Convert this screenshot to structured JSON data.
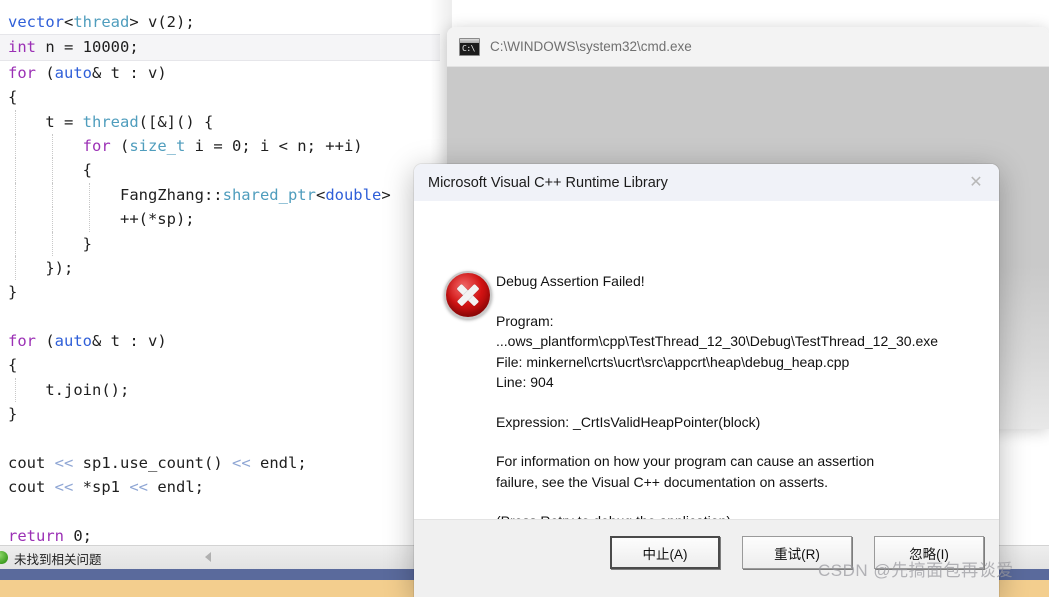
{
  "editor": {
    "lines": [
      {
        "indent": 0,
        "tokens": [
          {
            "t": "vector",
            "c": "bl"
          },
          {
            "t": "<",
            "c": "pl"
          },
          {
            "t": "thread",
            "c": "ty"
          },
          {
            "t": "> v(2);",
            "c": "pl"
          }
        ],
        "current": false,
        "guides": []
      },
      {
        "indent": 0,
        "tokens": [
          {
            "t": "int",
            "c": "k"
          },
          {
            "t": " n = ",
            "c": "pl"
          },
          {
            "t": "10000",
            "c": "pl"
          },
          {
            "t": ";",
            "c": "pl"
          }
        ],
        "current": true,
        "guides": []
      },
      {
        "indent": 0,
        "tokens": [
          {
            "t": "for",
            "c": "k"
          },
          {
            "t": " (",
            "c": "pl"
          },
          {
            "t": "auto",
            "c": "bl"
          },
          {
            "t": "& t : v)",
            "c": "pl"
          }
        ],
        "current": false,
        "guides": []
      },
      {
        "indent": 0,
        "tokens": [
          {
            "t": "{",
            "c": "pl"
          }
        ],
        "current": false,
        "guides": []
      },
      {
        "indent": 0,
        "tokens": [
          {
            "t": "    t = ",
            "c": "pl"
          },
          {
            "t": "thread",
            "c": "ty"
          },
          {
            "t": "([&]() {",
            "c": "pl"
          }
        ],
        "current": false,
        "guides": [
          "g1"
        ]
      },
      {
        "indent": 0,
        "tokens": [
          {
            "t": "        ",
            "c": "pl"
          },
          {
            "t": "for",
            "c": "k"
          },
          {
            "t": " (",
            "c": "pl"
          },
          {
            "t": "size_t",
            "c": "ty"
          },
          {
            "t": " i = 0; i < n; ++i)",
            "c": "pl"
          }
        ],
        "current": false,
        "guides": [
          "g1",
          "g2"
        ]
      },
      {
        "indent": 0,
        "tokens": [
          {
            "t": "        {",
            "c": "pl"
          }
        ],
        "current": false,
        "guides": [
          "g1",
          "g2"
        ]
      },
      {
        "indent": 0,
        "tokens": [
          {
            "t": "            FangZhang::",
            "c": "pl"
          },
          {
            "t": "shared_ptr",
            "c": "ty"
          },
          {
            "t": "<",
            "c": "pl"
          },
          {
            "t": "double",
            "c": "bl"
          },
          {
            "t": ">",
            "c": "pl"
          }
        ],
        "current": false,
        "guides": [
          "g1",
          "g2",
          "g3"
        ]
      },
      {
        "indent": 0,
        "tokens": [
          {
            "t": "            ++(*sp);",
            "c": "pl"
          }
        ],
        "current": false,
        "guides": [
          "g1",
          "g2",
          "g3"
        ]
      },
      {
        "indent": 0,
        "tokens": [
          {
            "t": "        }",
            "c": "pl"
          }
        ],
        "current": false,
        "guides": [
          "g1",
          "g2"
        ]
      },
      {
        "indent": 0,
        "tokens": [
          {
            "t": "    });",
            "c": "pl"
          }
        ],
        "current": false,
        "guides": [
          "g1"
        ]
      },
      {
        "indent": 0,
        "tokens": [
          {
            "t": "}",
            "c": "pl"
          }
        ],
        "current": false,
        "guides": []
      },
      {
        "indent": 0,
        "tokens": [
          {
            "t": " ",
            "c": "pl"
          }
        ],
        "current": false,
        "guides": []
      },
      {
        "indent": 0,
        "tokens": [
          {
            "t": "for",
            "c": "k"
          },
          {
            "t": " (",
            "c": "pl"
          },
          {
            "t": "auto",
            "c": "bl"
          },
          {
            "t": "& t : v)",
            "c": "pl"
          }
        ],
        "current": false,
        "guides": []
      },
      {
        "indent": 0,
        "tokens": [
          {
            "t": "{",
            "c": "pl"
          }
        ],
        "current": false,
        "guides": []
      },
      {
        "indent": 0,
        "tokens": [
          {
            "t": "    t.join();",
            "c": "pl"
          }
        ],
        "current": false,
        "guides": [
          "g1"
        ]
      },
      {
        "indent": 0,
        "tokens": [
          {
            "t": "}",
            "c": "pl"
          }
        ],
        "current": false,
        "guides": []
      },
      {
        "indent": 0,
        "tokens": [
          {
            "t": " ",
            "c": "pl"
          }
        ],
        "current": false,
        "guides": []
      },
      {
        "indent": 0,
        "tokens": [
          {
            "t": "cout ",
            "c": "pl"
          },
          {
            "t": "<<",
            "c": "op"
          },
          {
            "t": " sp1.",
            "c": "pl"
          },
          {
            "t": "use_count",
            "c": "pl"
          },
          {
            "t": "() ",
            "c": "pl"
          },
          {
            "t": "<<",
            "c": "op"
          },
          {
            "t": " endl;",
            "c": "pl"
          }
        ],
        "current": false,
        "guides": []
      },
      {
        "indent": 0,
        "tokens": [
          {
            "t": "cout ",
            "c": "pl"
          },
          {
            "t": "<<",
            "c": "op"
          },
          {
            "t": " *sp1 ",
            "c": "pl"
          },
          {
            "t": "<<",
            "c": "op"
          },
          {
            "t": " endl;",
            "c": "pl"
          }
        ],
        "current": false,
        "guides": []
      },
      {
        "indent": 0,
        "tokens": [
          {
            "t": " ",
            "c": "pl"
          }
        ],
        "current": false,
        "guides": []
      },
      {
        "indent": 0,
        "tokens": [
          {
            "t": "return",
            "c": "k"
          },
          {
            "t": " 0;",
            "c": "pl"
          }
        ],
        "current": false,
        "guides": []
      }
    ],
    "error_list": {
      "status_text": "未找到相关问题",
      "status_icon": "green-circle-icon",
      "collapse_icon": "triangle-left-icon"
    }
  },
  "console_window": {
    "title": "C:\\WINDOWS\\system32\\cmd.exe",
    "icon": "cmd-console-icon",
    "icon_glyph": "C:\\"
  },
  "dialog": {
    "title": "Microsoft Visual C++ Runtime Library",
    "close_label": "✕",
    "icon": "error-circle-icon",
    "heading": "Debug Assertion Failed!",
    "program_label": "Program:",
    "program_path": "...ows_plantform\\cpp\\TestThread_12_30\\Debug\\TestThread_12_30.exe",
    "file_line": "File: minkernel\\crts\\ucrt\\src\\appcrt\\heap\\debug_heap.cpp",
    "line_line": "Line: 904",
    "expression_line": "Expression: _CrtIsValidHeapPointer(block)",
    "info_line_1": "For information on how your program can cause an assertion",
    "info_line_2": "failure, see the Visual C++ documentation on asserts.",
    "press_line": "(Press Retry to debug the application)",
    "buttons": [
      {
        "label": "中止(A)",
        "focused": true
      },
      {
        "label": "重试(R)",
        "focused": false
      },
      {
        "label": "忽略(I)",
        "focused": false
      }
    ]
  },
  "watermark": {
    "text": "CSDN @先搞面包再谈爱"
  },
  "colors": {
    "keyword": "#9b30b5",
    "type": "#4f9dbd",
    "blue_identifier": "#2f5fd8",
    "operator": "#8fa6d4",
    "status_bar": "#5a6a9c",
    "bottom_strip": "#f3ce8e",
    "error_red": "#d41414"
  }
}
